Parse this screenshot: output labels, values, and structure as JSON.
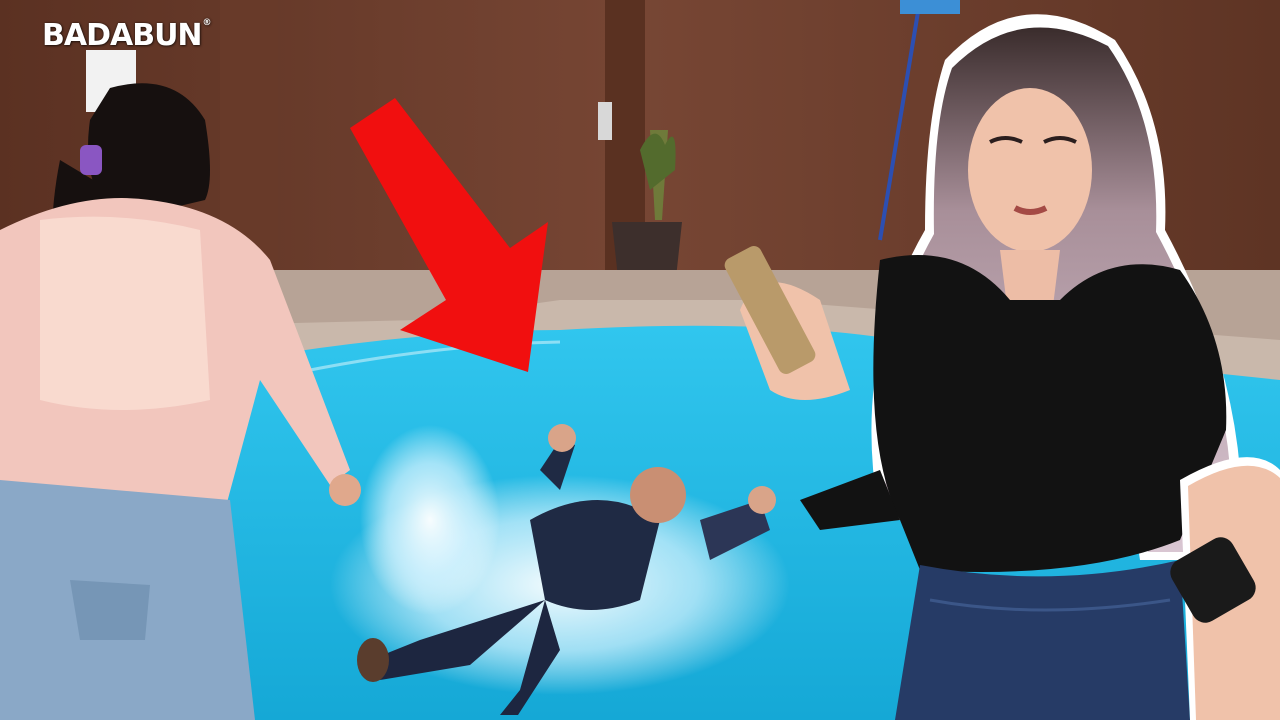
{
  "watermark": {
    "brand": "BADABUN",
    "registered": "®"
  },
  "colors": {
    "wall": "#6e3f2d",
    "pool_water": "#23b7e0",
    "arrow_red": "#f10f0f",
    "cutout_outline": "#ffffff"
  },
  "scene": {
    "subjects": [
      "woman-in-pink-sweater",
      "man-falling-into-pool",
      "woman-with-phone"
    ],
    "arrow_direction": "down-right"
  }
}
